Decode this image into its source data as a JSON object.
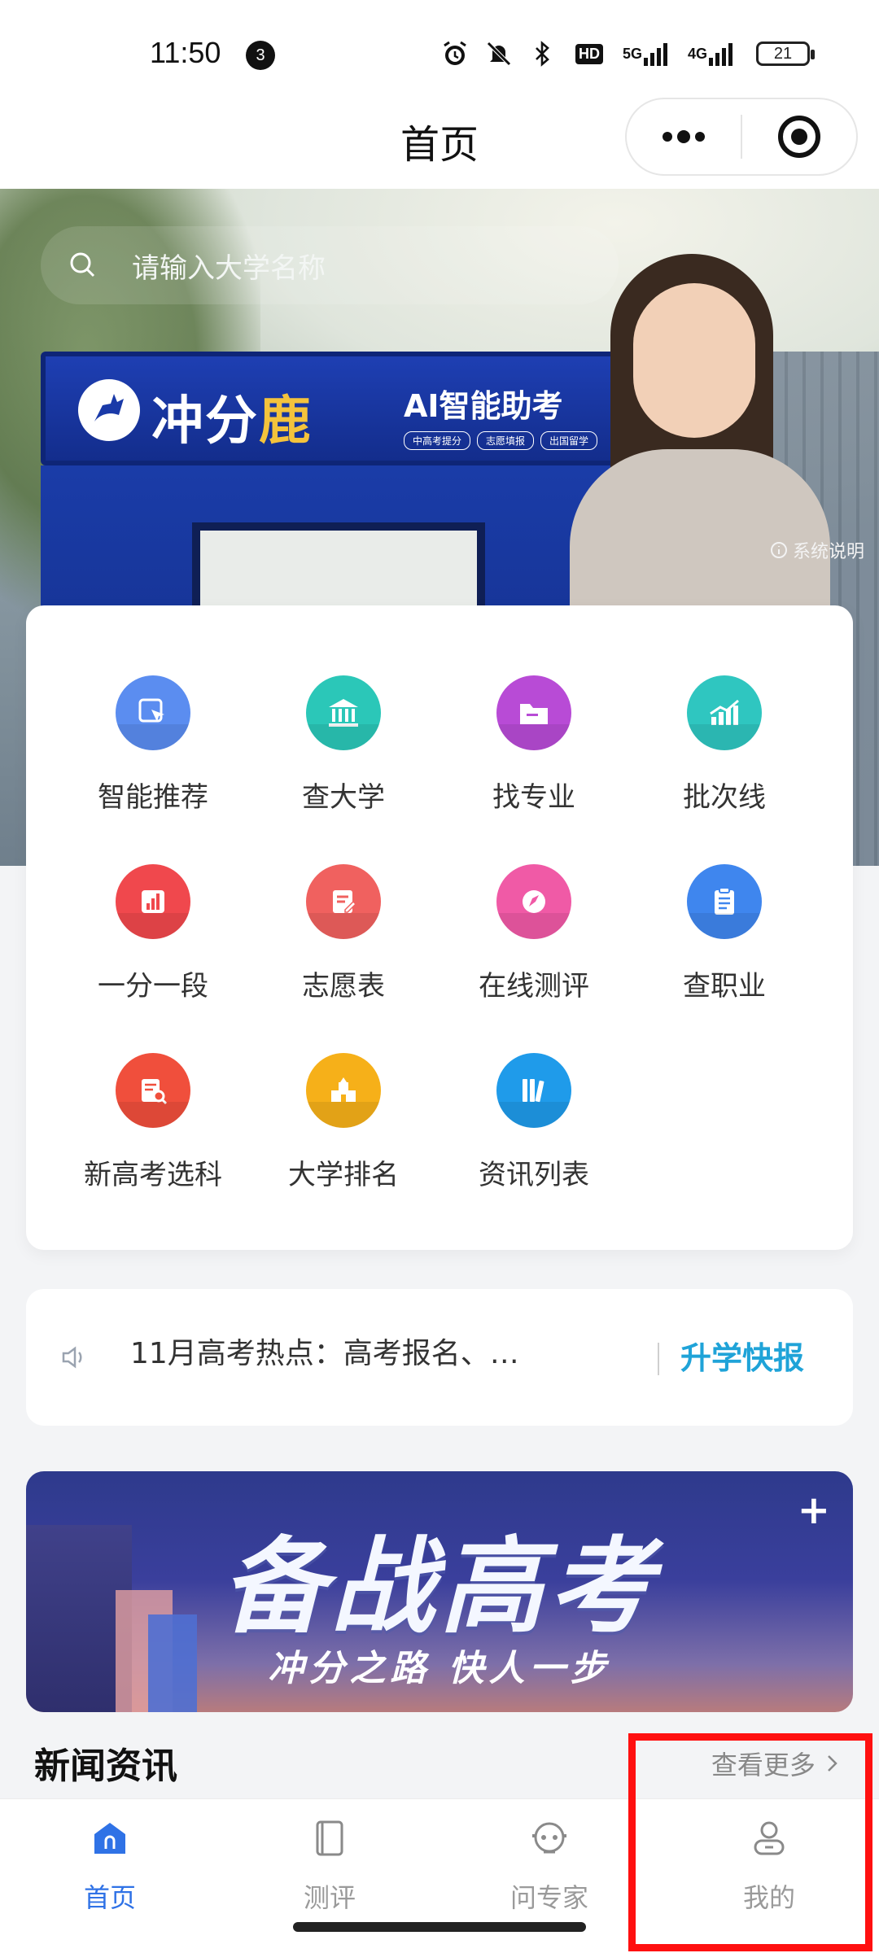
{
  "status_bar": {
    "time": "11:50",
    "notification_count": "3",
    "network_5g": "5G",
    "network_4g": "4G",
    "hd": "HD",
    "battery": "21"
  },
  "nav": {
    "title": "首页"
  },
  "hero": {
    "search_placeholder": "请输入大学名称",
    "brand_main": "冲分",
    "brand_accent": "鹿",
    "ai_tag": "AI智能助考",
    "pills": [
      "中高考提分",
      "志愿填报",
      "出国留学"
    ],
    "system_note": "系统说明"
  },
  "functions": [
    {
      "label": "智能推荐",
      "icon": "pointer-icon",
      "color": "#5b8df0"
    },
    {
      "label": "查大学",
      "icon": "university-icon",
      "color": "#2bc7b8"
    },
    {
      "label": "找专业",
      "icon": "folder-icon",
      "color": "#b84bd6"
    },
    {
      "label": "批次线",
      "icon": "chart-icon",
      "color": "#2fc6c0"
    },
    {
      "label": "一分一段",
      "icon": "bar-icon",
      "color": "#f0484d"
    },
    {
      "label": "志愿表",
      "icon": "form-icon",
      "color": "#f0615f"
    },
    {
      "label": "在线测评",
      "icon": "pen-icon",
      "color": "#f05aa6"
    },
    {
      "label": "查职业",
      "icon": "clipboard-icon",
      "color": "#3f86ee"
    },
    {
      "label": "新高考选科",
      "icon": "doc-search-icon",
      "color": "#f04f3c"
    },
    {
      "label": "大学排名",
      "icon": "school-icon",
      "color": "#f6b019"
    },
    {
      "label": "资讯列表",
      "icon": "books-icon",
      "color": "#1f9bea"
    }
  ],
  "notice": {
    "text": "11月高考热点：高考报名、…",
    "quick": "升学快报"
  },
  "promo": {
    "title": "备战高考",
    "subtitle": "冲分之路 快人一步",
    "plus": "+"
  },
  "news": {
    "title": "新闻资讯",
    "more": "查看更多"
  },
  "tabs": [
    {
      "label": "首页",
      "icon": "home-icon",
      "active": true
    },
    {
      "label": "测评",
      "icon": "book-icon",
      "active": false
    },
    {
      "label": "问专家",
      "icon": "expert-icon",
      "active": false
    },
    {
      "label": "我的",
      "icon": "user-icon",
      "active": false
    }
  ],
  "colors": {
    "accent": "#2f72e6",
    "highlight": "#ff1010",
    "quick": "#1fa3d8"
  }
}
